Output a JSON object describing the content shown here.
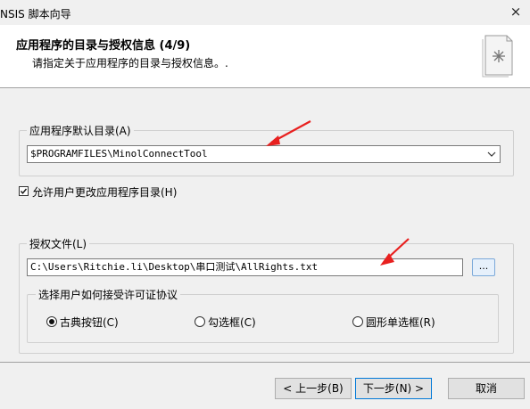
{
  "window": {
    "title": "NSIS 脚本向导",
    "close_glyph": "×"
  },
  "header": {
    "title": "应用程序的目录与授权信息 (4/9)",
    "subtitle": "请指定关于应用程序的目录与授权信息。."
  },
  "default_dir": {
    "label": "应用程序默认目录(A)",
    "value": "$PROGRAMFILES\\MinolConnectTool"
  },
  "allow_change": {
    "label": "允许用户更改应用程序目录(H)",
    "checked": true
  },
  "license": {
    "label": "授权文件(L)",
    "value": "C:\\Users\\Ritchie.li\\Desktop\\串口测试\\AllRights.txt",
    "browse_label": "..."
  },
  "accept_mode": {
    "label": "选择用户如何接受许可证协议",
    "options": [
      {
        "label": "古典按钮(C)",
        "selected": true
      },
      {
        "label": "勾选框(C)",
        "selected": false
      },
      {
        "label": "圆形单选框(R)",
        "selected": false
      }
    ]
  },
  "buttons": {
    "back": "< 上一步(B)",
    "next": "下一步(N) >",
    "cancel": "取消"
  },
  "colors": {
    "annotation_arrow": "#e8201f",
    "focus_border": "#0078d7"
  },
  "icons": [
    "close-icon",
    "wizard-page-icon",
    "dropdown-arrow-icon",
    "checkbox-checked-icon",
    "annotation-arrow"
  ]
}
